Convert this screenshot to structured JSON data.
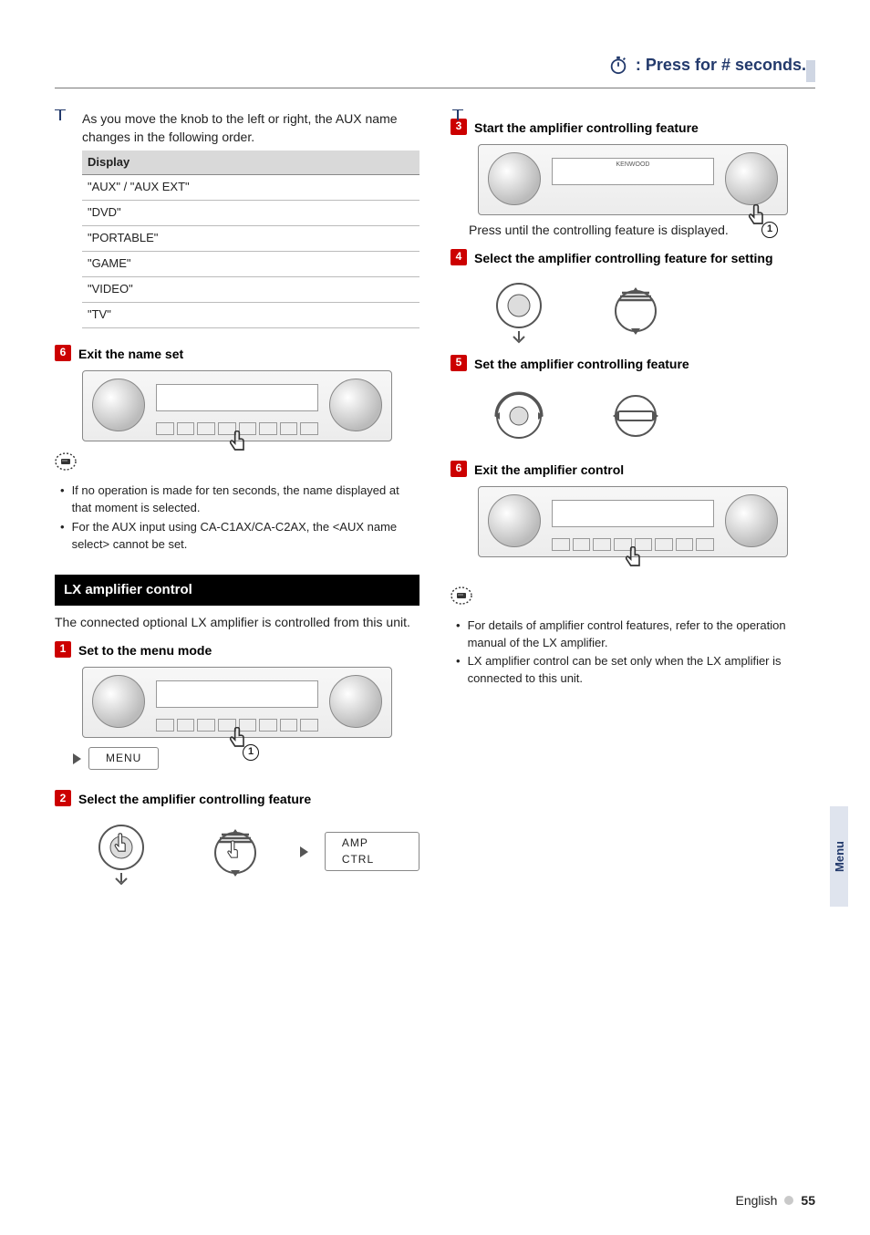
{
  "header": {
    "press_text": ": Press for # seconds."
  },
  "left": {
    "intro_text": "As you move the knob to the left or right, the AUX name changes in the following order.",
    "display": {
      "header": "Display",
      "rows": [
        "\"AUX\" / \"AUX EXT\"",
        "\"DVD\"",
        "\"PORTABLE\"",
        "\"GAME\"",
        "\"VIDEO\"",
        "\"TV\""
      ]
    },
    "step6": {
      "num": "6",
      "title": "Exit the name set"
    },
    "notes": [
      "If no operation is made for ten seconds, the name displayed at that moment is selected.",
      "For the AUX input using CA-C1AX/CA-C2AX, the <AUX name select> cannot be set."
    ],
    "lx_heading": "LX amplifier control",
    "lx_intro": "The connected optional LX amplifier is controlled from this unit.",
    "step1": {
      "num": "1",
      "title": "Set to the menu mode",
      "pill": "MENU"
    },
    "step2": {
      "num": "2",
      "title": "Select the amplifier controlling feature",
      "pill": "AMP CTRL"
    }
  },
  "right": {
    "step3": {
      "num": "3",
      "title": "Start the amplifier controlling feature",
      "caption": "Press until the controlling feature is displayed."
    },
    "step4": {
      "num": "4",
      "title": "Select the amplifier controlling feature for setting"
    },
    "step5": {
      "num": "5",
      "title": "Set the amplifier controlling feature"
    },
    "step6": {
      "num": "6",
      "title": "Exit the amplifier control"
    },
    "notes": [
      "For details of amplifier control features, refer to the operation manual of the LX amplifier.",
      "LX amplifier control can be set only when the LX amplifier is connected to this unit."
    ]
  },
  "panel_brand": "KENWOOD",
  "side_tab": "Menu",
  "footer": {
    "lang": "English",
    "page": "55"
  }
}
